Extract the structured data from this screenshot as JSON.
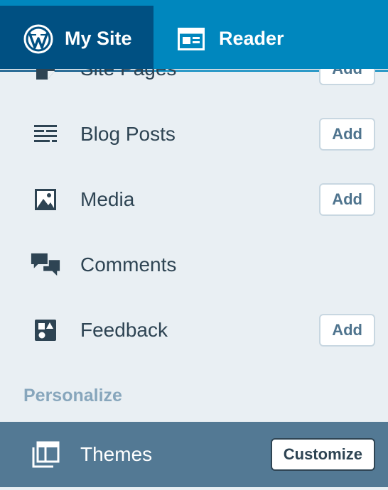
{
  "topbar": {
    "my_site": {
      "label": "My Site",
      "icon": "wordpress-logo-icon"
    },
    "reader": {
      "label": "Reader",
      "icon": "reader-icon"
    }
  },
  "menu": {
    "items": [
      {
        "label": "Site Pages",
        "icon": "page-icon",
        "button": "Add"
      },
      {
        "label": "Blog Posts",
        "icon": "posts-icon",
        "button": "Add"
      },
      {
        "label": "Media",
        "icon": "image-icon",
        "button": "Add"
      },
      {
        "label": "Comments",
        "icon": "comments-icon",
        "button": ""
      },
      {
        "label": "Feedback",
        "icon": "feedback-icon",
        "button": "Add"
      }
    ],
    "section_heading": "Personalize",
    "themes": {
      "label": "Themes",
      "icon": "themes-icon",
      "button": "Customize"
    }
  },
  "colors": {
    "masterbar": "#0087be",
    "masterbar_active": "#005082",
    "sidebar_bg": "#e9eff3",
    "selected_row": "#537994",
    "text": "#2e4453",
    "section_heading": "#87a6bc"
  }
}
